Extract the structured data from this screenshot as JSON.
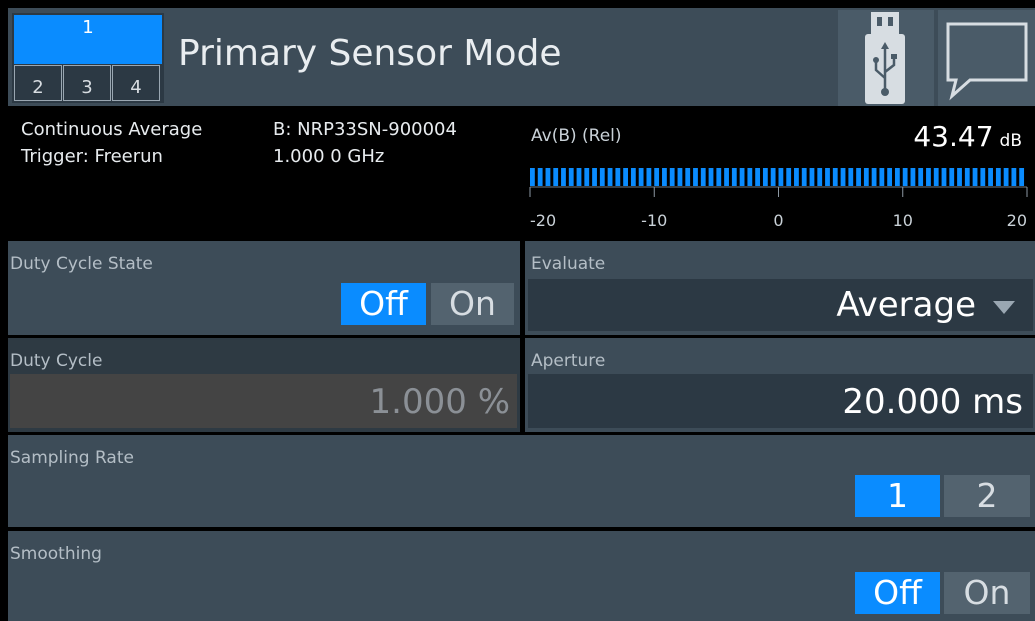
{
  "header": {
    "title": "Primary Sensor Mode",
    "channels": [
      "1",
      "2",
      "3",
      "4"
    ],
    "selected_channel": "1",
    "usb_icon": "usb-icon",
    "message_icon": "message-icon"
  },
  "measurement": {
    "mode": "Continuous Average",
    "trigger": "Trigger: Freerun",
    "sensor": "B: NRP33SN-900004",
    "frequency": "1.000 0 GHz",
    "graph_label": "Av(B) (Rel)",
    "value": "43.47",
    "unit": "dB",
    "scale_ticks": [
      "-20",
      "-10",
      "0",
      "10",
      "20"
    ],
    "bar_fill_fraction": 1.0
  },
  "settings": {
    "duty_cycle_state": {
      "label": "Duty Cycle State",
      "options": [
        "Off",
        "On"
      ],
      "selected": "Off"
    },
    "evaluate": {
      "label": "Evaluate",
      "value": "Average"
    },
    "duty_cycle": {
      "label": "Duty Cycle",
      "value": "1.000 %"
    },
    "aperture": {
      "label": "Aperture",
      "value": "20.000 ms"
    },
    "sampling_rate": {
      "label": "Sampling Rate",
      "options": [
        "1",
        "2"
      ],
      "selected": "1"
    },
    "smoothing": {
      "label": "Smoothing",
      "options": [
        "Off",
        "On"
      ],
      "selected": "Off"
    }
  },
  "colors": {
    "accent": "#0a8cff",
    "panel": "#3d4c58",
    "field": "#2c3944",
    "background": "#000000"
  }
}
